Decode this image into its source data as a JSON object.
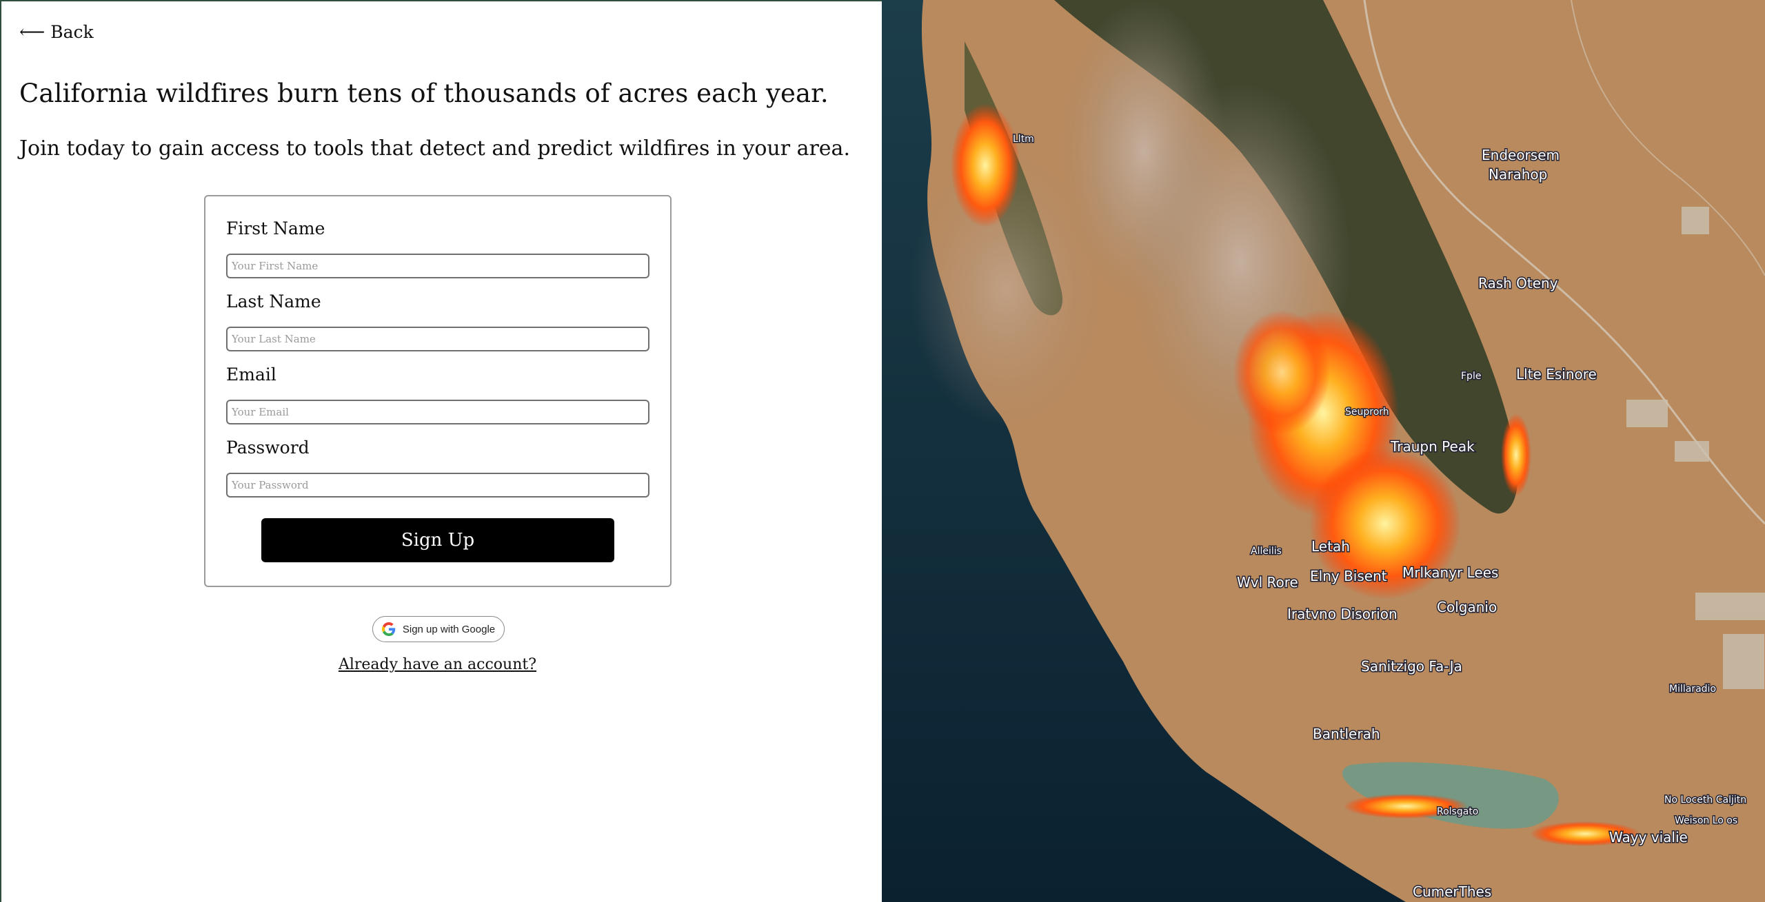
{
  "back": {
    "arrow": "⟵",
    "label": "Back"
  },
  "headline": "California wildfires burn tens of thousands of acres each year.",
  "subhead": "Join today to gain access to tools that detect and predict wildfires in your area.",
  "form": {
    "first_name": {
      "label": "First Name",
      "placeholder": "Your First Name",
      "value": ""
    },
    "last_name": {
      "label": "Last Name",
      "placeholder": "Your Last Name",
      "value": ""
    },
    "email": {
      "label": "Email",
      "placeholder": "Your Email",
      "value": ""
    },
    "password": {
      "label": "Password",
      "placeholder": "Your Password",
      "value": ""
    },
    "submit_label": "Sign Up"
  },
  "google": {
    "label": "Sign up with Google",
    "icon": "google-g-icon"
  },
  "login_link": "Already have an account?",
  "map": {
    "image": "satellite-wildfire-map",
    "labels": [
      "Lltm",
      "Endeorsem",
      "Narahop",
      "Rash Oteny",
      "Fple",
      "Llte Esinore",
      "Seuprorh",
      "Traupn Peak",
      "Letah",
      "Alleilis",
      "Wvl Rore",
      "Elny Bisent",
      "Mrlkanyr Lees",
      "Colganio",
      "Iratvno Disorion",
      "Sanitzigo Fa-Ja",
      "Millaradio",
      "Bantlerah",
      "Rolsgato",
      "No Loceth Caljitn",
      "Weison Lo os",
      "Wayy vialie",
      "CumerThes"
    ]
  }
}
